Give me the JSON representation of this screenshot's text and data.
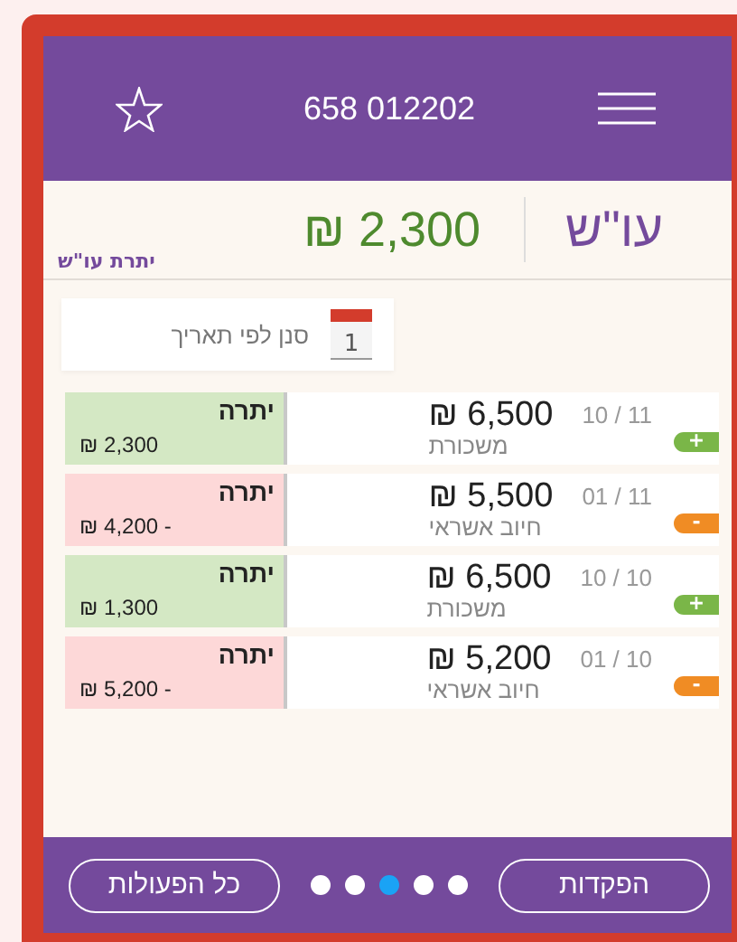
{
  "header": {
    "title": "658 012202"
  },
  "balance": {
    "account": "עו\"ש",
    "amount": "₪ 2,300",
    "label": "יתרת עו\"ש"
  },
  "filter": {
    "label": "סנן לפי תאריך",
    "calendar_day": "1"
  },
  "transactions": [
    {
      "kind": "credit",
      "sign": "+",
      "date": "10 / 11",
      "amount": "₪ 6,500",
      "description": "משכורת",
      "balance_label": "יתרה",
      "balance": "₪ 2,300"
    },
    {
      "kind": "debit",
      "sign": "-",
      "date": "01 / 11",
      "amount": "₪ 5,500",
      "description": "חיוב אשראי",
      "balance_label": "יתרה",
      "balance": "₪ 4,200 -"
    },
    {
      "kind": "credit",
      "sign": "+",
      "date": "10 / 10",
      "amount": "₪ 6,500",
      "description": "משכורת",
      "balance_label": "יתרה",
      "balance": "₪ 1,300"
    },
    {
      "kind": "debit",
      "sign": "-",
      "date": "01 / 10",
      "amount": "₪ 5,200",
      "description": "חיוב אשראי",
      "balance_label": "יתרה",
      "balance": "₪ 5,200 -"
    }
  ],
  "footer": {
    "deposits_button": "הפקדות",
    "all_actions_button": "כל הפעולות",
    "pages": [
      {
        "selected": false
      },
      {
        "selected": false
      },
      {
        "selected": true
      },
      {
        "selected": false
      },
      {
        "selected": false
      }
    ]
  }
}
